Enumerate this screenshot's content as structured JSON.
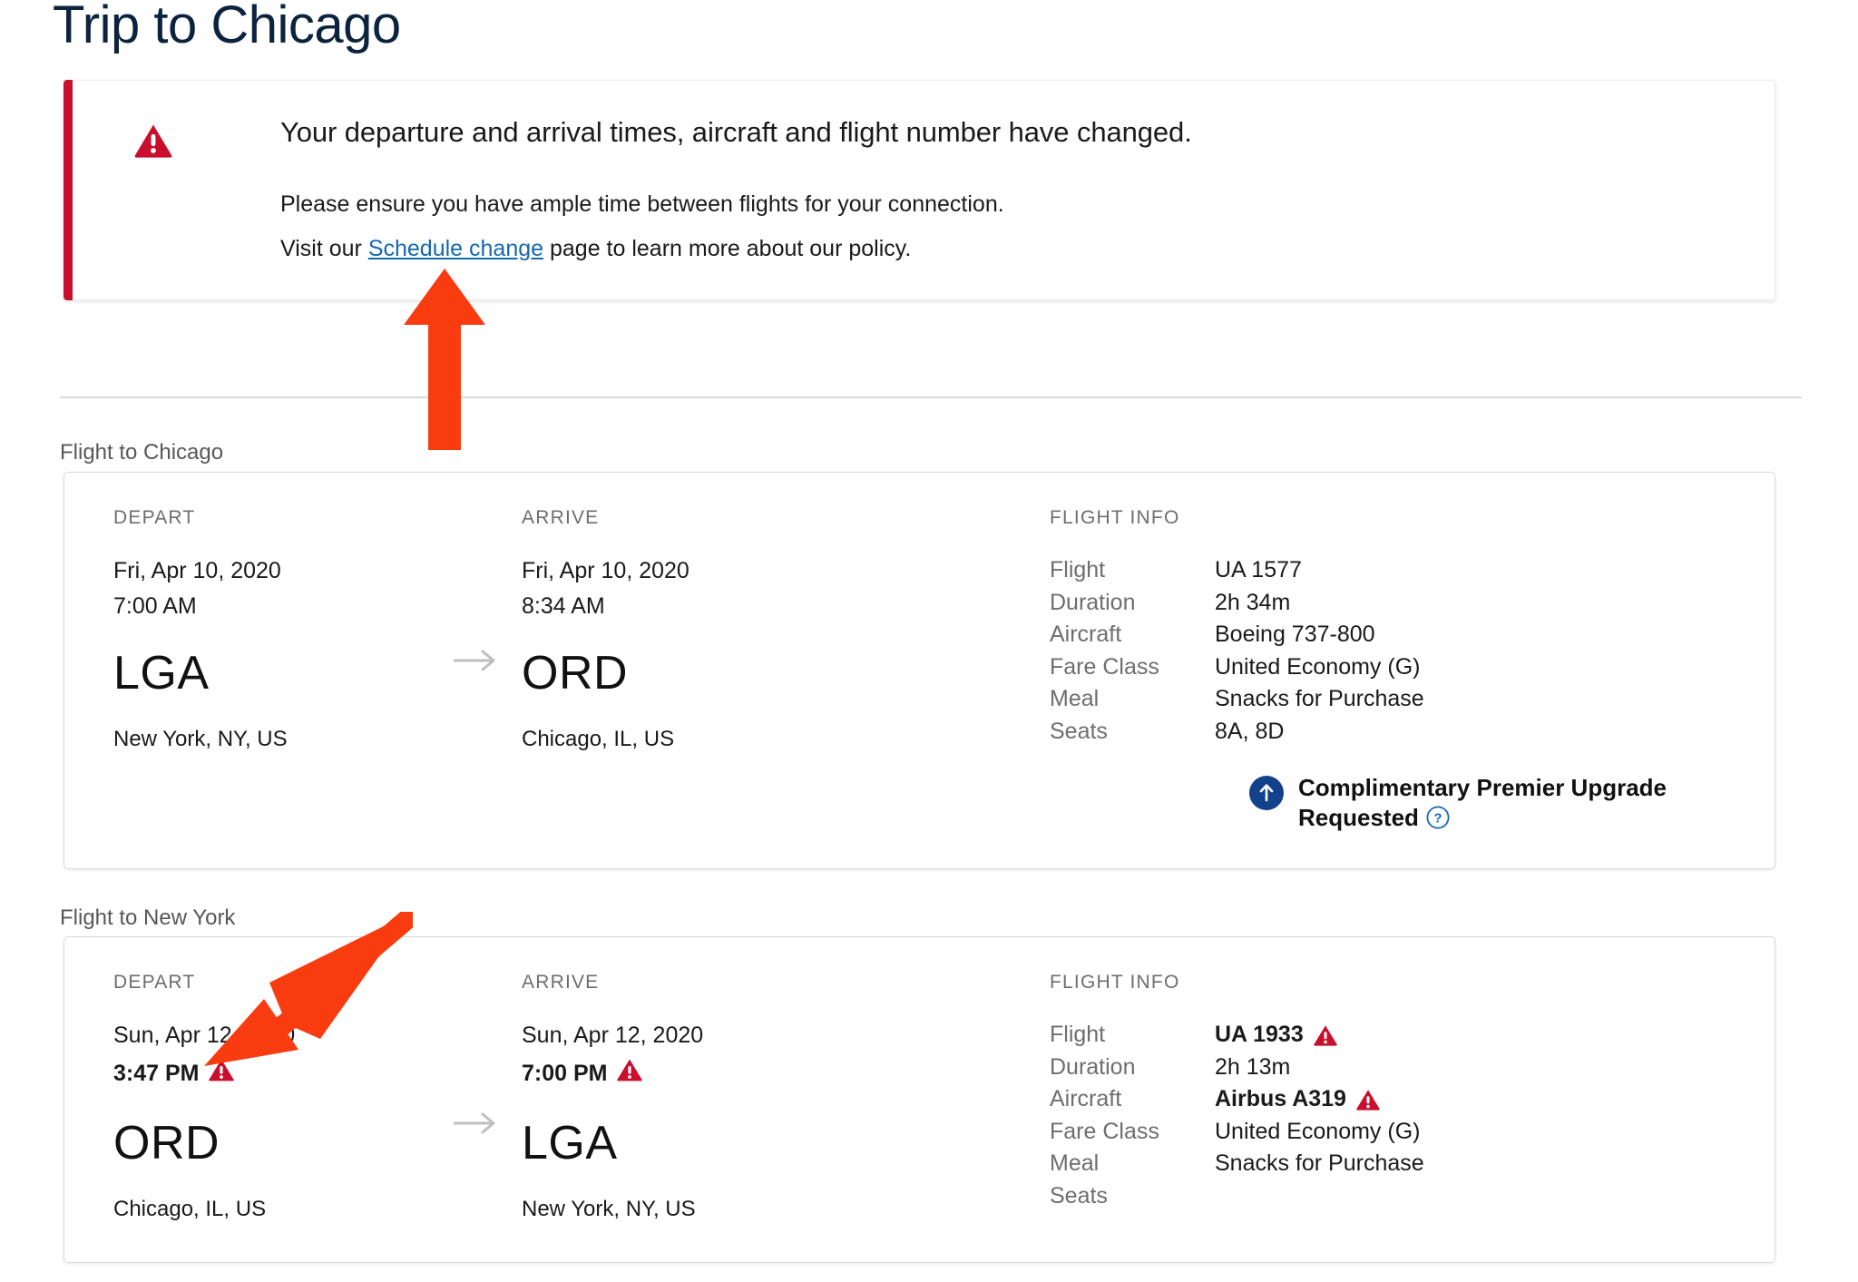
{
  "page": {
    "title": "Trip to Chicago"
  },
  "alert": {
    "icon": "warning-triangle-icon",
    "accent_color": "#C8102E",
    "heading": "Your departure and arrival times, aircraft and flight number have changed.",
    "line1": "Please ensure you have ample time between flights for your connection.",
    "line2_before": "Visit our ",
    "link_text": "Schedule change",
    "line2_after": " page to learn more about our policy."
  },
  "flights": [
    {
      "section_label": "Flight to Chicago",
      "depart": {
        "head": "DEPART",
        "date": "Fri, Apr 10, 2020",
        "time": "7:00 AM",
        "time_changed": false,
        "code": "LGA",
        "city": "New York, NY, US"
      },
      "arrive": {
        "head": "ARRIVE",
        "date": "Fri, Apr 10, 2020",
        "time": "8:34 AM",
        "time_changed": false,
        "code": "ORD",
        "city": "Chicago, IL, US"
      },
      "info": {
        "head": "FLIGHT INFO",
        "rows": [
          {
            "key": "Flight",
            "value": "UA 1577",
            "changed": false
          },
          {
            "key": "Duration",
            "value": "2h 34m",
            "changed": false
          },
          {
            "key": "Aircraft",
            "value": "Boeing 737-800",
            "changed": false
          },
          {
            "key": "Fare Class",
            "value": "United Economy (G)",
            "changed": false
          },
          {
            "key": "Meal",
            "value": "Snacks for Purchase",
            "changed": false
          },
          {
            "key": "Seats",
            "value": "8A,  8D",
            "changed": false
          }
        ]
      },
      "upgrade": {
        "icon": "upgrade-arrow-icon",
        "text": "Complimentary Premier Upgrade Requested",
        "help_icon": "help-question-icon"
      }
    },
    {
      "section_label": "Flight to New York",
      "depart": {
        "head": "DEPART",
        "date": "Sun, Apr 12, 2020",
        "time": "3:47 PM",
        "time_changed": true,
        "code": "ORD",
        "city": "Chicago, IL, US"
      },
      "arrive": {
        "head": "ARRIVE",
        "date": "Sun, Apr 12, 2020",
        "time": "7:00 PM",
        "time_changed": true,
        "code": "LGA",
        "city": "New York, NY, US"
      },
      "info": {
        "head": "FLIGHT INFO",
        "rows": [
          {
            "key": "Flight",
            "value": "UA 1933",
            "changed": true
          },
          {
            "key": "Duration",
            "value": "2h 13m",
            "changed": false
          },
          {
            "key": "Aircraft",
            "value": "Airbus A319",
            "changed": true
          },
          {
            "key": "Fare Class",
            "value": "United Economy (G)",
            "changed": false
          },
          {
            "key": "Meal",
            "value": "Snacks for Purchase",
            "changed": false
          },
          {
            "key": "Seats",
            "value": "",
            "changed": false
          }
        ]
      },
      "upgrade": null
    }
  ],
  "annotations": [
    {
      "name": "annotation-arrow-up",
      "color": "#F93B10"
    },
    {
      "name": "annotation-arrow-diagonal",
      "color": "#F93B10"
    }
  ],
  "colors": {
    "title": "#0C2340",
    "alert_bar": "#C8102E",
    "warning": "#C8102E",
    "link": "#1668B0",
    "upgrade_badge": "#14418B",
    "help_icon": "#1668B0",
    "annotation": "#F93B10"
  }
}
